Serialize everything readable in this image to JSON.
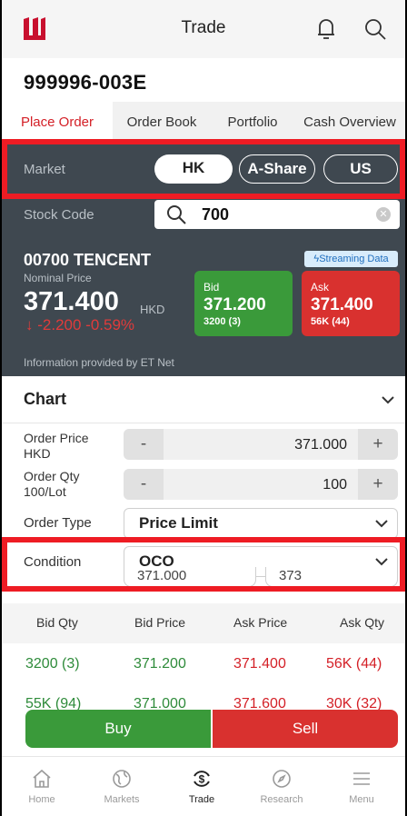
{
  "topbar": {
    "title": "Trade"
  },
  "account": {
    "id": "999996-003E"
  },
  "tabs": [
    {
      "label": "Place Order",
      "active": true
    },
    {
      "label": "Order Book",
      "active": false
    },
    {
      "label": "Portfolio",
      "active": false
    },
    {
      "label": "Cash Overview",
      "active": false
    }
  ],
  "market": {
    "label": "Market",
    "options": [
      "HK",
      "A-Share",
      "US"
    ],
    "selected": "HK"
  },
  "stock": {
    "label": "Stock Code",
    "value": "700"
  },
  "quote": {
    "name": "00700 TENCENT",
    "streaming": "Streaming Data",
    "nominal_label": "Nominal Price",
    "price": "371.400",
    "currency": "HKD",
    "change": "-2.200 -0.59%",
    "bid_label": "Bid",
    "bid_price": "371.200",
    "bid_volume": "3200 (3)",
    "ask_label": "Ask",
    "ask_price": "371.400",
    "ask_volume": "56K (44)",
    "source": "Information provided by ET Net"
  },
  "chart": {
    "label": "Chart"
  },
  "form": {
    "price_label": "Order Price\nHKD",
    "price_value": "371.000",
    "qty_label": "Order Qty\n100/Lot",
    "qty_value": "100",
    "minus": "-",
    "plus": "+",
    "type_label": "Order Type",
    "type_value": "Price Limit",
    "condition_label": "Condition",
    "condition_value": "OCO",
    "oco_price_1": "371.000",
    "oco_price_2": "373"
  },
  "orderbook": {
    "headers": [
      "Bid Qty",
      "Bid Price",
      "Ask Price",
      "Ask Qty"
    ],
    "rows": [
      [
        "3200 (3)",
        "371.200",
        "371.400",
        "56K (44)"
      ],
      [
        "55K (94)",
        "371.000",
        "371.600",
        "30K (32)"
      ]
    ]
  },
  "actions": {
    "buy": "Buy",
    "sell": "Sell"
  },
  "nav": [
    {
      "label": "Home",
      "icon": "home-icon",
      "active": false
    },
    {
      "label": "Markets",
      "icon": "globe-icon",
      "active": false
    },
    {
      "label": "Trade",
      "icon": "trade-icon",
      "active": true
    },
    {
      "label": "Research",
      "icon": "compass-icon",
      "active": false
    },
    {
      "label": "Menu",
      "icon": "menu-icon",
      "active": false
    }
  ],
  "colors": {
    "brand": "#c8102e",
    "bid": "#3a9a3a",
    "ask": "#d9312f",
    "dark_panel": "#3f4850",
    "highlight_box": "#ee1c24"
  }
}
